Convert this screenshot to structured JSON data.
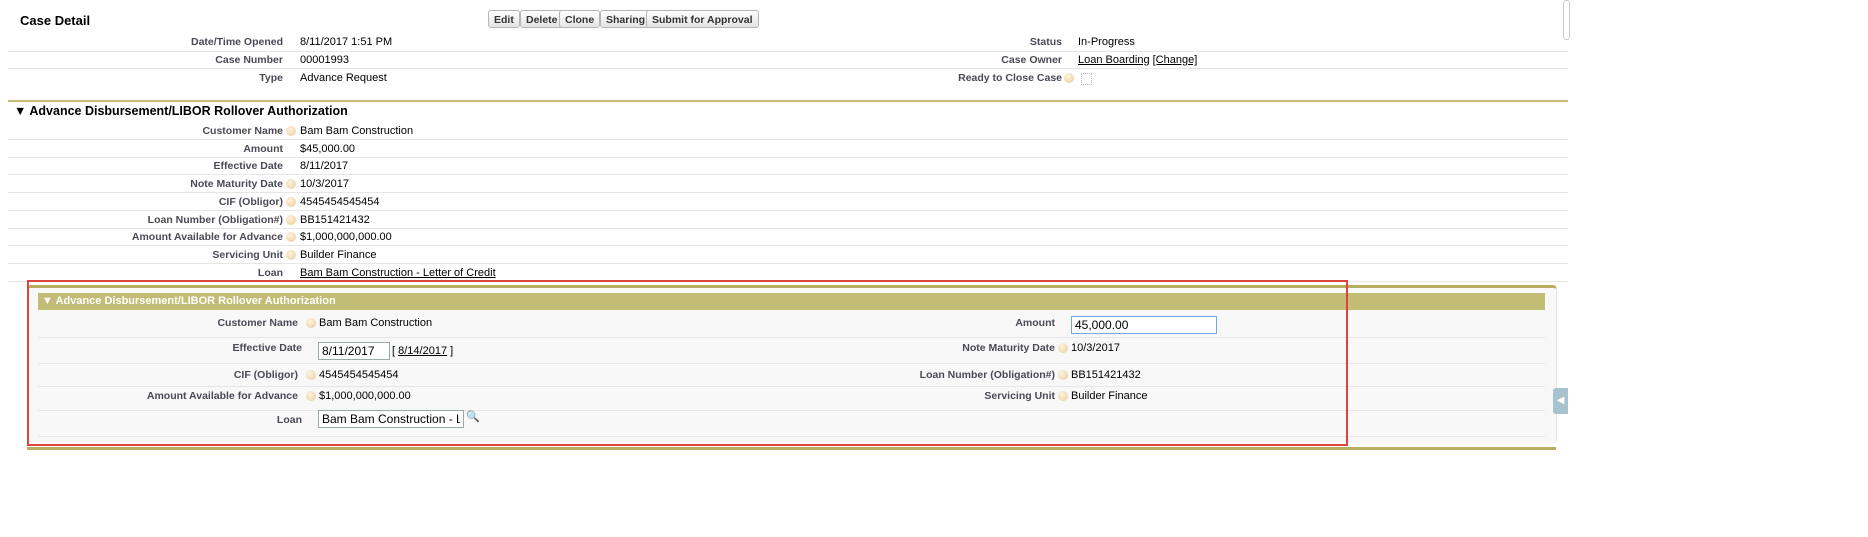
{
  "header": {
    "title": "Case Detail",
    "buttons": [
      "Edit",
      "Delete",
      "Clone",
      "Sharing",
      "Submit for Approval"
    ]
  },
  "case_fields_left": [
    {
      "label": "Date/Time Opened",
      "value": "8/11/2017 1:51 PM"
    },
    {
      "label": "Case Number",
      "value": "00001993"
    },
    {
      "label": "Type",
      "value": "Advance Request"
    }
  ],
  "case_fields_right": {
    "status_label": "Status",
    "status_value": "In-Progress",
    "owner_label": "Case Owner",
    "owner_value": "Loan Boarding",
    "owner_change": "[Change]",
    "ready_label": "Ready to Close Case",
    "ready_checked": false
  },
  "section": {
    "title": "Advance Disbursement/LIBOR Rollover Authorization",
    "fields": [
      {
        "label": "Customer Name",
        "value": "Bam Bam Construction",
        "help": true
      },
      {
        "label": "Amount",
        "value": "$45,000.00",
        "help": false
      },
      {
        "label": "Effective Date",
        "value": "8/11/2017",
        "help": false
      },
      {
        "label": "Note Maturity Date",
        "value": "10/3/2017",
        "help": true
      },
      {
        "label": "CIF (Obligor)",
        "value": "4545454545454",
        "help": true
      },
      {
        "label": "Loan Number (Obligation#)",
        "value": "BB151421432",
        "help": true
      },
      {
        "label": "Amount Available for Advance",
        "value": "$1,000,000,000.00",
        "help": true
      },
      {
        "label": "Servicing Unit",
        "value": "Builder Finance",
        "help": true
      },
      {
        "label": "Loan",
        "value": "Bam Bam Construction - Letter of Credit",
        "help": false,
        "link": true
      }
    ]
  },
  "edit_section": {
    "title": "Advance Disbursement/LIBOR Rollover Authorization",
    "customer_name_label": "Customer Name",
    "customer_name_value": "Bam Bam Construction",
    "amount_label": "Amount",
    "amount_value": "45,000.00",
    "effective_date_label": "Effective Date",
    "effective_date_value": "8/11/2017",
    "effective_date_today": "8/14/2017",
    "note_maturity_label": "Note Maturity Date",
    "note_maturity_value": "10/3/2017",
    "cif_label": "CIF (Obligor)",
    "cif_value": "4545454545454",
    "loan_number_label": "Loan Number (Obligation#)",
    "loan_number_value": "BB151421432",
    "available_label": "Amount Available for Advance",
    "available_value": "$1,000,000,000.00",
    "servicing_label": "Servicing Unit",
    "servicing_value": "Builder Finance",
    "loan_label": "Loan",
    "loan_value": "Bam Bam Construction - Letter of Credit"
  },
  "colors": {
    "accent": "#c2bc74",
    "highlight": "#e0423d"
  }
}
